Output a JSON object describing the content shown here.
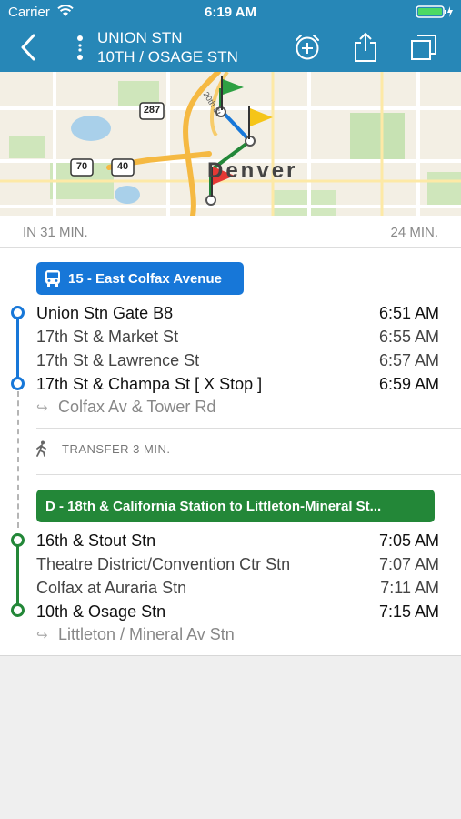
{
  "status": {
    "carrier": "Carrier",
    "time": "6:19 AM"
  },
  "nav": {
    "origin": "UNION STN",
    "destination": "10TH / OSAGE STN"
  },
  "map": {
    "city_label": "Denver",
    "highway_shields": [
      "287",
      "70",
      "40"
    ],
    "street_label": "20th St"
  },
  "trip": {
    "departs_in": "IN 31 MIN.",
    "duration": "24 MIN."
  },
  "legs": [
    {
      "route_label": "15 - East Colfax Avenue",
      "color": "#1777d8",
      "stops": [
        {
          "name": "Union Stn Gate B8",
          "time": "6:51 AM"
        },
        {
          "name": "17th St & Market St",
          "time": "6:55 AM"
        },
        {
          "name": "17th St & Lawrence St",
          "time": "6:57 AM"
        },
        {
          "name": "17th St & Champa St [ X Stop ]",
          "time": "6:59 AM"
        }
      ],
      "headsign": "Colfax Av & Tower Rd"
    },
    {
      "route_label": "D - 18th & California Station to Littleton-Mineral St...",
      "color": "#238738",
      "stops": [
        {
          "name": "16th & Stout Stn",
          "time": "7:05 AM"
        },
        {
          "name": "Theatre District/Convention Ctr Stn",
          "time": "7:07 AM"
        },
        {
          "name": "Colfax at Auraria Stn",
          "time": "7:11 AM"
        },
        {
          "name": "10th & Osage Stn",
          "time": "7:15 AM"
        }
      ],
      "headsign": "Littleton / Mineral Av Stn"
    }
  ],
  "transfer": {
    "label": "TRANSFER 3 MIN."
  },
  "colors": {
    "header": "#2787b7",
    "bus": "#1777d8",
    "rail": "#238738"
  }
}
